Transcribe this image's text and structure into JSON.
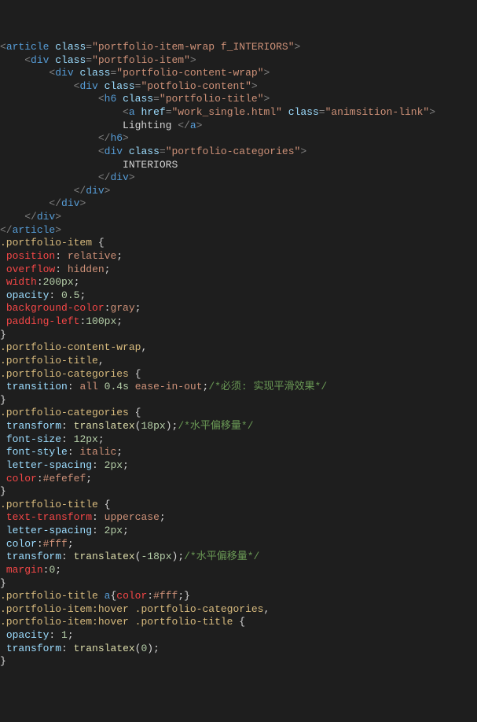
{
  "html": {
    "article_open": "article",
    "article_open_attrs": [
      [
        "class",
        "\"portfolio-item-wrap f_INTERIORS\""
      ]
    ],
    "div1_attrs": [
      [
        "class",
        "\"portfolio-item\""
      ]
    ],
    "div2_attrs": [
      [
        "class",
        "\"portfolio-content-wrap\""
      ]
    ],
    "div3_attrs": [
      [
        "class",
        "\"potfolio-content\""
      ]
    ],
    "h6_attrs": [
      [
        "class",
        "\"portfolio-title\""
      ]
    ],
    "a_attrs": [
      [
        "href",
        "\"work_single.html\""
      ],
      [
        "class",
        "\"animsition-link\""
      ]
    ],
    "a_text": "Lighting ",
    "div4_attrs": [
      [
        "class",
        "\"portfolio-categories\""
      ]
    ],
    "div4_text": "INTERIORS"
  },
  "css": {
    "r1": {
      "sel": ".portfolio-item",
      "decls": [
        [
          "position",
          "relative",
          true
        ],
        [
          "overflow",
          "hidden",
          true
        ],
        [
          "width",
          "200px",
          true
        ],
        [
          "opacity",
          "0.5",
          false
        ],
        [
          "background-color",
          "gray",
          true
        ],
        [
          "padding-left",
          "100px",
          true
        ]
      ]
    },
    "r2": {
      "sels": [
        ".portfolio-content-wrap",
        ".portfolio-title",
        ".portfolio-categories"
      ],
      "decls": [
        [
          "transition",
          "all 0.4s ease-in-out",
          false,
          "/*必须: 实现平滑效果*/"
        ]
      ]
    },
    "r3": {
      "sel": ".portfolio-categories",
      "decls": [
        [
          "transform",
          "translatex(18px)",
          false,
          "/*水平偏移量*/"
        ],
        [
          "font-size",
          "12px",
          false
        ],
        [
          "font-style",
          "italic",
          false
        ],
        [
          "letter-spacing",
          "2px",
          false
        ],
        [
          "color",
          "#efefef",
          true
        ]
      ]
    },
    "r4": {
      "sel": ".portfolio-title",
      "decls": [
        [
          "text-transform",
          "uppercase",
          true
        ],
        [
          "letter-spacing",
          "2px",
          false
        ],
        [
          "color",
          "#fff",
          false
        ],
        [
          "transform",
          "translatex(-18px)",
          false,
          "/*水平偏移量*/"
        ],
        [
          "margin",
          "0",
          true
        ]
      ]
    },
    "r5line": {
      "sel": ".portfolio-title a",
      "prop": "color",
      "val": "#fff"
    },
    "r6": {
      "sels": [
        ".portfolio-item:hover .portfolio-categories",
        ".portfolio-item:hover .portfolio-title"
      ],
      "decls": [
        [
          "opacity",
          "1",
          false
        ],
        [
          "transform",
          "translatex(0)",
          false
        ]
      ]
    }
  }
}
